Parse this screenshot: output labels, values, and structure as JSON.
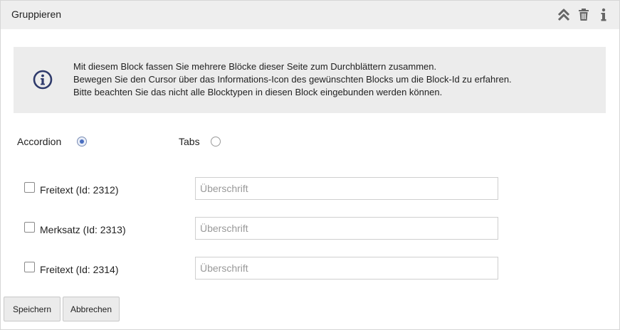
{
  "panel": {
    "title": "Gruppieren",
    "header_icons": [
      "collapse-up-icon",
      "trash-icon",
      "info-icon"
    ]
  },
  "info": {
    "icon": "info-circle-icon",
    "lines": [
      "Mit diesem Block fassen Sie mehrere Blöcke dieser Seite zum Durchblättern zusammen.",
      "Bewegen Sie den Cursor über das Informations-Icon des gewünschten Blocks um die Block-Id zu erfahren.",
      "Bitte beachten Sie das nicht alle Blocktypen in diesen Block eingebunden werden können."
    ]
  },
  "mode": {
    "options": [
      {
        "label": "Accordion",
        "selected": true
      },
      {
        "label": "Tabs",
        "selected": false
      }
    ]
  },
  "blocks": [
    {
      "label": "Freitext (Id: 2312)",
      "checked": false,
      "value": "",
      "placeholder": "Überschrift"
    },
    {
      "label": "Merksatz (Id: 2313)",
      "checked": false,
      "value": "",
      "placeholder": "Überschrift"
    },
    {
      "label": "Freitext (Id: 2314)",
      "checked": false,
      "value": "",
      "placeholder": "Überschrift"
    }
  ],
  "actions": {
    "save_label": "Speichern",
    "cancel_label": "Abbrechen"
  },
  "colors": {
    "header_bg": "#eeeeee",
    "info_bg": "#ececec",
    "info_icon": "#2e3a6b",
    "icon_gray": "#666666"
  }
}
